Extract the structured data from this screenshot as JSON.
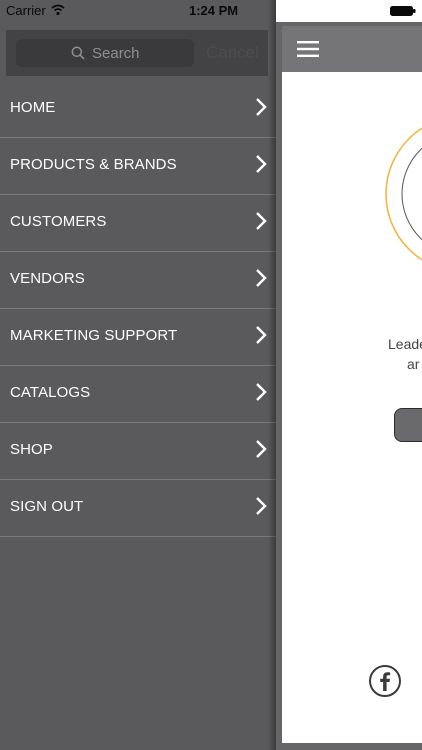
{
  "status_bar": {
    "carrier": "Carrier",
    "time": "1:24 PM"
  },
  "search": {
    "placeholder": "Search",
    "cancel_label": "Cancel"
  },
  "menu": {
    "items": [
      {
        "label": "HOME"
      },
      {
        "label": "PRODUCTS & BRANDS"
      },
      {
        "label": "CUSTOMERS"
      },
      {
        "label": "VENDORS"
      },
      {
        "label": "MARKETING SUPPORT"
      },
      {
        "label": "CATALOGS"
      },
      {
        "label": "SHOP"
      },
      {
        "label": "SIGN OUT"
      }
    ]
  },
  "main": {
    "tagline_line1": "Leade",
    "tagline_line2": "ar"
  },
  "icons": {
    "wifi": "wifi-icon",
    "search": "search-icon",
    "chevron": "chevron-right-icon",
    "battery": "battery-icon",
    "menu": "hamburger-icon",
    "facebook": "facebook-icon"
  },
  "colors": {
    "drawer_bg": "#5a5a5c",
    "separator": "#7a7a7c",
    "logo_outer_ring": "#f5b335",
    "nav_bar": "#757577",
    "text_white": "#ffffff"
  }
}
